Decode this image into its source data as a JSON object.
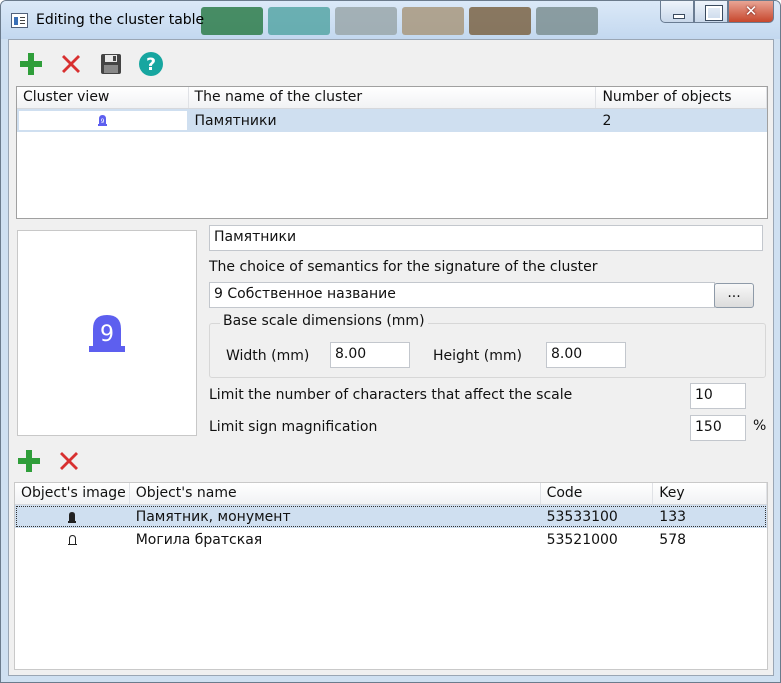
{
  "window": {
    "title": "Editing the cluster table",
    "blob_colors": [
      "#2e7d4a",
      "#57a6a6",
      "#9aa7aa",
      "#a8987e",
      "#7b6445",
      "#7d8f92"
    ]
  },
  "toolbar_top": {
    "add_icon": "plus-icon",
    "delete_icon": "x-icon",
    "save_icon": "floppy-disk-icon",
    "help_icon": "question-icon"
  },
  "cluster_table": {
    "headers": [
      "Cluster view",
      "The name of the cluster",
      "Number of objects"
    ],
    "rows": [
      {
        "view_icon": "cluster-9-icon",
        "name": "Памятники",
        "count": "2"
      }
    ]
  },
  "preview": {
    "glyph": "9",
    "color": "#5d5fef"
  },
  "form": {
    "cluster_name": "Памятники",
    "semantics_label": "The choice of semantics for the signature of the cluster",
    "semantics_value": "9  Собственное название",
    "browse_label": "...",
    "base_scale_label": "Base scale dimensions (mm)",
    "width_label": "Width (mm)",
    "width_value": "8.00",
    "height_label": "Height (mm)",
    "height_value": "8.00",
    "limit_chars_label": "Limit the number of characters that affect the scale",
    "limit_chars_value": "10",
    "limit_mag_label": "Limit sign magnification",
    "limit_mag_value": "150",
    "percent": "%"
  },
  "toolbar_objects": {
    "add_icon": "plus-icon",
    "delete_icon": "x-icon"
  },
  "objects_table": {
    "headers": [
      "Object's image",
      "Object's name",
      "Code",
      "Key"
    ],
    "rows": [
      {
        "image_icon": "monument-filled-icon",
        "name": "Памятник, монумент",
        "code": "53533100",
        "key": "133"
      },
      {
        "image_icon": "grave-outline-icon",
        "name": "Могила братская",
        "code": "53521000",
        "key": "578"
      }
    ]
  }
}
